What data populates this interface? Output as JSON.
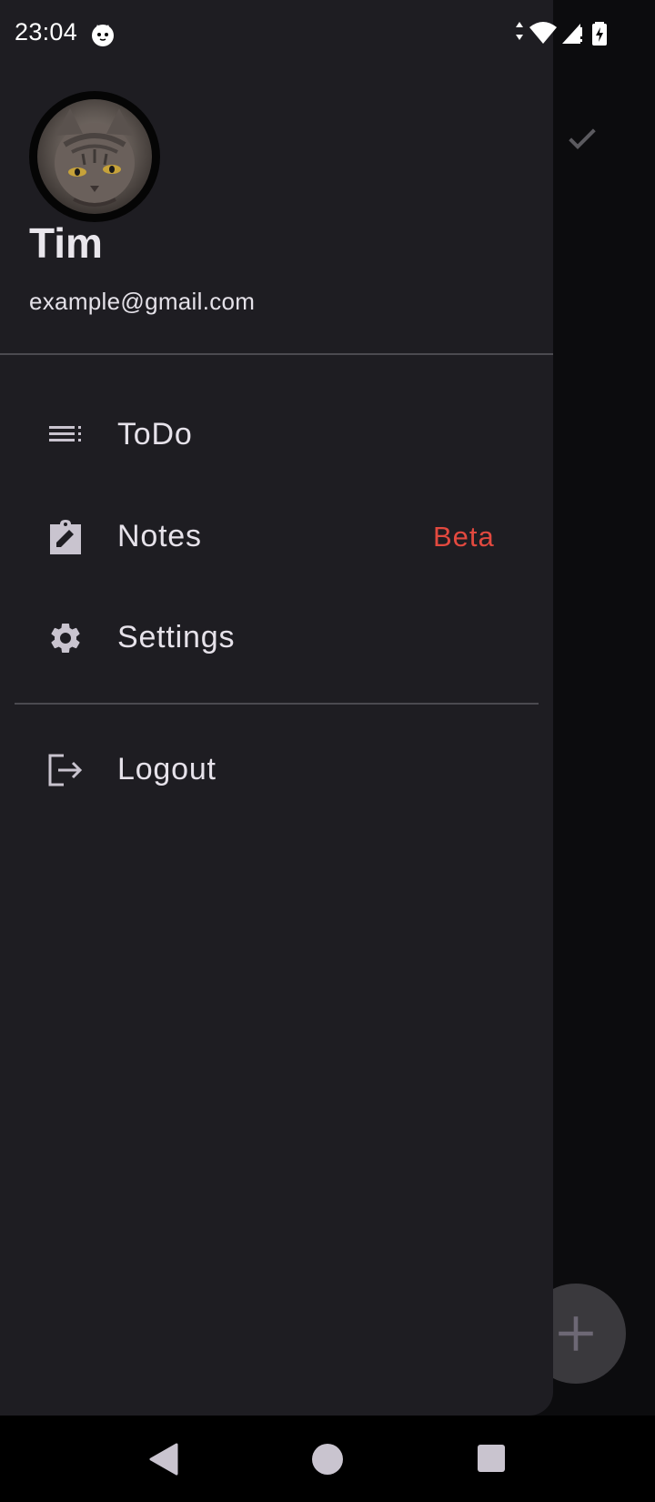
{
  "status_bar": {
    "time": "23:04",
    "notification_icon": "cat-icon",
    "icons": [
      "data-transfer-icon",
      "wifi-icon",
      "cell-signal-icon",
      "battery-charging-icon"
    ]
  },
  "background": {
    "check_icon": "check-icon",
    "fab_icon": "plus-icon"
  },
  "drawer": {
    "user": {
      "name": "Tim",
      "email": "example@gmail.com",
      "avatar_icon": "cat-avatar"
    },
    "items": [
      {
        "label": "ToDo",
        "icon": "list-icon"
      },
      {
        "label": "Notes",
        "icon": "clipboard-edit-icon",
        "badge": "Beta"
      },
      {
        "label": "Settings",
        "icon": "gear-icon"
      },
      {
        "label": "Logout",
        "icon": "logout-icon"
      }
    ]
  },
  "colors": {
    "drawer_bg": "#1e1d22",
    "text": "#e6e2ea",
    "icon": "#c9c4cf",
    "badge": "#e2493f",
    "scrim": "#0c0c0e"
  },
  "nav_bar": {
    "icons": [
      "back-icon",
      "home-icon",
      "recents-icon"
    ]
  }
}
